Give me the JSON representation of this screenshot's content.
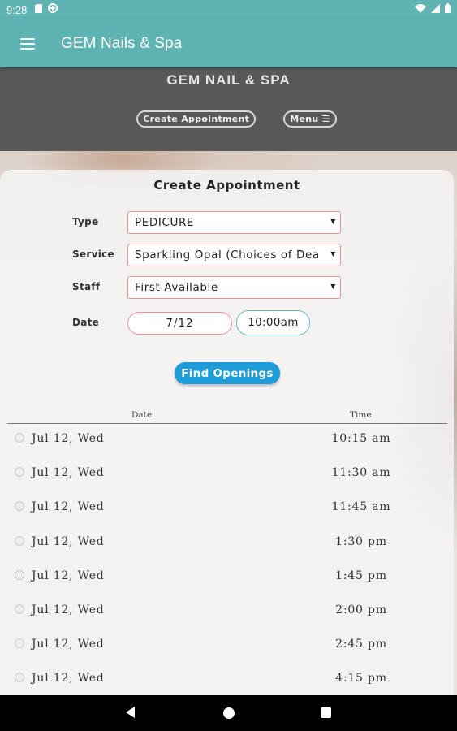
{
  "status_bar": {
    "time": "9:28",
    "icons": [
      "sd-card-icon",
      "data-saver-icon"
    ],
    "right_icons": [
      "wifi-icon",
      "signal-icon",
      "battery-icon"
    ]
  },
  "app_bar": {
    "title": "GEM Nails & Spa"
  },
  "site_header": {
    "title": "GEM NAIL & SPA",
    "create_appointment_label": "Create Appointment",
    "menu_label": "Menu ☰"
  },
  "form": {
    "title": "Create Appointment",
    "type_label": "Type",
    "type_value": "PEDICURE",
    "service_label": "Service",
    "service_value": "Sparkling Opal (Choices of Dea",
    "staff_label": "Staff",
    "staff_value": "First Available",
    "date_label": "Date",
    "date_value": "7/12",
    "time_value": "10:00am",
    "find_openings_label": "Find Openings"
  },
  "table": {
    "date_header": "Date",
    "time_header": "Time",
    "slots": [
      {
        "date": "Jul 12, Wed",
        "time": "10:15 am"
      },
      {
        "date": "Jul 12, Wed",
        "time": "11:30 am"
      },
      {
        "date": "Jul 12, Wed",
        "time": "11:45 am"
      },
      {
        "date": "Jul 12, Wed",
        "time": "1:30 pm"
      },
      {
        "date": "Jul 12, Wed",
        "time": "1:45 pm"
      },
      {
        "date": "Jul 12, Wed",
        "time": "2:00 pm"
      },
      {
        "date": "Jul 12, Wed",
        "time": "2:45 pm"
      },
      {
        "date": "Jul 12, Wed",
        "time": "4:15 pm"
      }
    ]
  },
  "colors": {
    "app_bar": "#5fb3b3",
    "header": "#595959",
    "find_button": "#1f9bd8",
    "field_border": "#ef8f98",
    "time_border": "#69b8c9"
  }
}
